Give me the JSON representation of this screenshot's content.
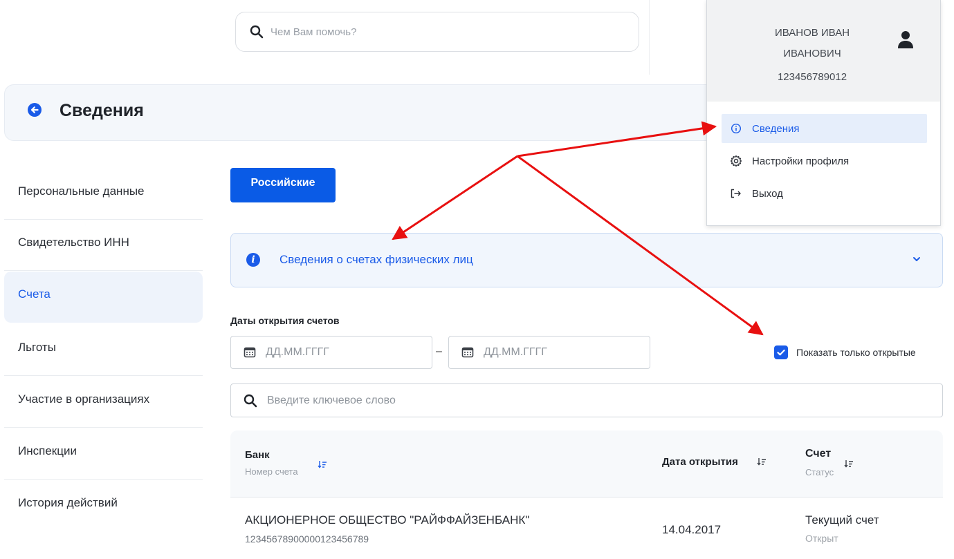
{
  "top_search": {
    "placeholder": "Чем Вам помочь?"
  },
  "header": {
    "title": "Сведения"
  },
  "sidebar": {
    "items": [
      {
        "label": "Персональные данные"
      },
      {
        "label": "Свидетельство ИНН"
      },
      {
        "label": "Счета",
        "active": true
      },
      {
        "label": "Льготы"
      },
      {
        "label": "Участие в организациях"
      },
      {
        "label": "Инспекции"
      },
      {
        "label": "История действий"
      }
    ]
  },
  "main": {
    "tab_button": "Российские",
    "info_panel": {
      "title": "Сведения о счетах физических лиц"
    },
    "dates": {
      "label": "Даты открытия счетов",
      "from_placeholder": "ДД.ММ.ГГГГ",
      "to_placeholder": "ДД.ММ.ГГГГ",
      "separator": "–"
    },
    "only_open": {
      "label": "Показать только открытые",
      "checked": true
    },
    "keyword_search": {
      "placeholder": "Введите ключевое слово"
    },
    "table": {
      "columns": [
        {
          "title": "Банк",
          "subtitle": "Номер счета"
        },
        {
          "title": "Дата открытия",
          "subtitle": ""
        },
        {
          "title": "Счет",
          "subtitle": "Статус"
        }
      ],
      "rows": [
        {
          "bank": "АКЦИОНЕРНОЕ ОБЩЕСТВО \"РАЙФФАЙЗЕНБАНК\"",
          "account_number": "12345678900000123456789",
          "open_date": "14.04.2017",
          "account_type": "Текущий счет",
          "status": "Открыт"
        }
      ]
    }
  },
  "profile_menu": {
    "name_line1": "ИВАНОВ ИВАН",
    "name_line2": "ИВАНОВИЧ",
    "inn": "123456789012",
    "items": [
      {
        "label": "Сведения",
        "icon": "info-icon",
        "active": true
      },
      {
        "label": "Настройки профиля",
        "icon": "gear-icon"
      },
      {
        "label": "Выход",
        "icon": "logout-icon"
      }
    ]
  },
  "colors": {
    "accent": "#1a5be8",
    "annotation": "#e81010"
  }
}
